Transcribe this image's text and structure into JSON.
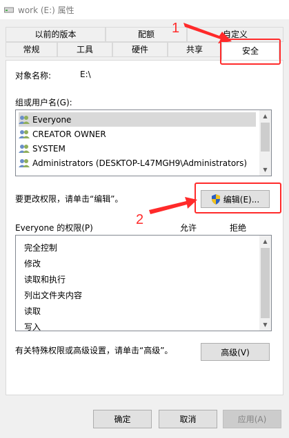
{
  "window": {
    "title": "work (E:) 属性"
  },
  "tabs": {
    "back": [
      "以前的版本",
      "配额",
      "自定义"
    ],
    "front": [
      "常规",
      "工具",
      "硬件",
      "共享",
      "安全"
    ]
  },
  "security": {
    "object_label": "对象名称:",
    "object_value": "E:\\",
    "groups_label": "组或用户名(G):",
    "users": [
      "Everyone",
      "CREATOR OWNER",
      "SYSTEM",
      "Administrators (DESKTOP-L47MGH9\\Administrators)"
    ],
    "change_hint": "要更改权限，请单击“编辑”。",
    "edit_button": "编辑(E)...",
    "perm_label": "Everyone 的权限(P)",
    "allow_col": "允许",
    "deny_col": "拒绝",
    "permissions": [
      "完全控制",
      "修改",
      "读取和执行",
      "列出文件夹内容",
      "读取",
      "写入"
    ],
    "advanced_hint": "有关特殊权限或高级设置，请单击“高级”。",
    "advanced_button": "高级(V)"
  },
  "footer": {
    "ok": "确定",
    "cancel": "取消",
    "apply": "应用(A)"
  },
  "annotations": {
    "one": "1",
    "two": "2",
    "color": "#ff2a2a"
  },
  "icons": {
    "title": "drive-icon",
    "user": "users-icon",
    "shield": "uac-shield-icon"
  }
}
